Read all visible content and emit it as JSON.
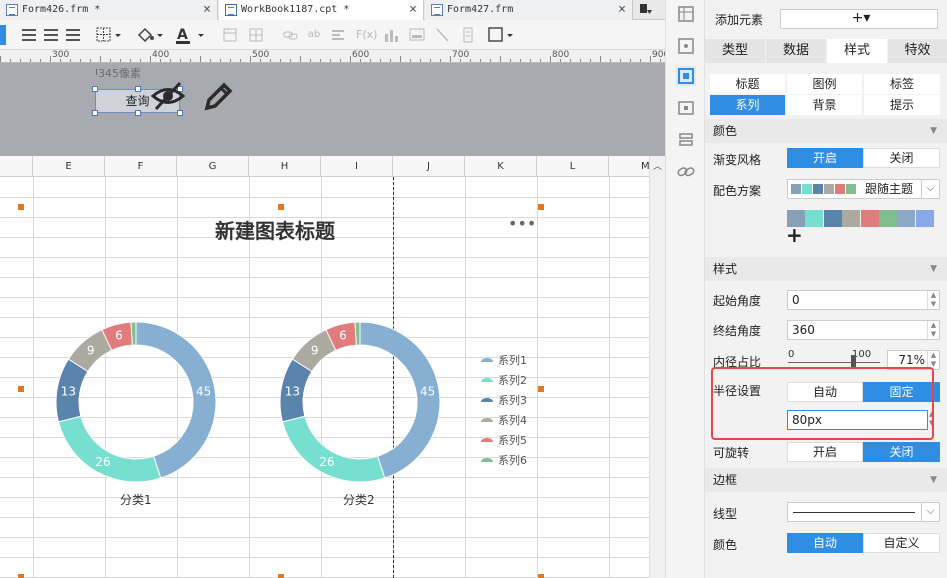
{
  "tabs": [
    {
      "label": "Form426.frm *",
      "close": "×"
    },
    {
      "label": "WorkBook1187.cpt *",
      "close": "×"
    },
    {
      "label": "Form427.frm",
      "close": "×"
    }
  ],
  "ruler": [
    "300",
    "400",
    "500",
    "600",
    "700",
    "800",
    "900"
  ],
  "form": {
    "size_label": "345像素",
    "query_button": "查询"
  },
  "columns": [
    "E",
    "F",
    "G",
    "H",
    "I",
    "J",
    "K",
    "L",
    "M"
  ],
  "chart": {
    "title": "新建图表标题",
    "more": "•••",
    "donuts": [
      {
        "category": "分类1"
      },
      {
        "category": "分类2"
      }
    ],
    "slice_labels": [
      "45",
      "26",
      "13",
      "9",
      "6"
    ],
    "legend": [
      "系列1",
      "系列2",
      "系列3",
      "系列4",
      "系列5",
      "系列6"
    ],
    "colors": [
      "#87afd1",
      "#77dfd0",
      "#5b84ad",
      "#aca9a0",
      "#e07c7c",
      "#7fbf8f"
    ]
  },
  "panel": {
    "add_element": "添加元素",
    "add_symbol": "+▾",
    "top_tabs": [
      "类型",
      "数据",
      "样式",
      "特效"
    ],
    "sub_tabs": [
      "标题",
      "图例",
      "标签",
      "系列",
      "背景",
      "提示"
    ],
    "color_section": "颜色",
    "gradient_label": "渐变风格",
    "gradient_on": "开启",
    "gradient_off": "关闭",
    "scheme_label": "配色方案",
    "scheme_value": "跟随主题",
    "scheme_colors": [
      "#87a0b8",
      "#77dfd0",
      "#5b84ad",
      "#aca9a0",
      "#e07c7c",
      "#7fbf8f",
      "#8ea8c8",
      "#8aa8e8"
    ],
    "style_section": "样式",
    "start_angle_label": "起始角度",
    "start_angle": "0",
    "end_angle_label": "终结角度",
    "end_angle": "360",
    "inner_ratio_label": "内径占比",
    "slider_min": "0",
    "slider_max": "100",
    "inner_ratio": "71%",
    "inner_ratio_fraction": 0.71,
    "radius_label": "半径设置",
    "radius_auto": "自动",
    "radius_fixed": "固定",
    "radius_value": "80px",
    "rotate_label": "可旋转",
    "rotate_on": "开启",
    "rotate_off": "关闭",
    "border_section": "边框",
    "line_label": "线型",
    "border_color_label": "颜色",
    "border_auto": "自动",
    "border_custom": "自定义"
  }
}
